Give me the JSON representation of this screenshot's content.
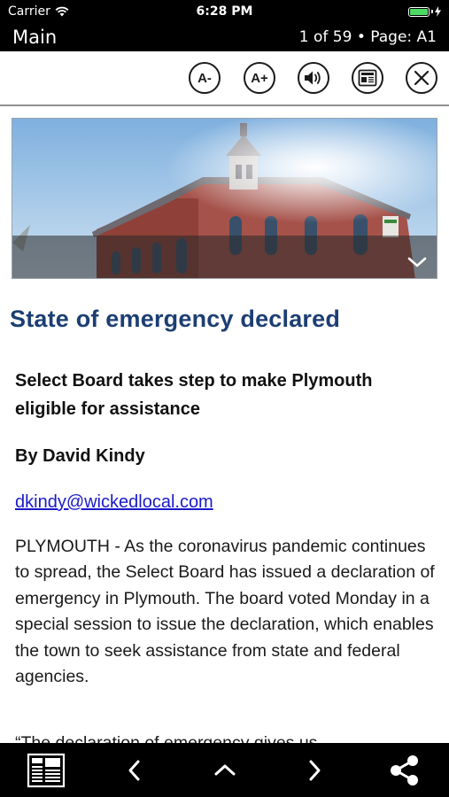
{
  "status_bar": {
    "carrier": "Carrier",
    "time": "6:28 PM"
  },
  "title_bar": {
    "section": "Main",
    "page_info": "1 of 59 • Page: A1"
  },
  "toolbar": {
    "decrease_font": "A-",
    "increase_font": "A+"
  },
  "article": {
    "headline": "State of emergency declared",
    "subheadline": "Select Board takes step to make Plymouth eligible for assistance",
    "byline": "By David Kindy",
    "email": "dkindy@wickedlocal.com",
    "paragraph_1": "PLYMOUTH - As the coronavirus pandemic continues to spread, the Select Board has issued a declaration of emergency in Plymouth. The board voted Monday in a special session to issue the declaration, which enables the town to seek assistance from state and federal agencies.",
    "paragraph_2_partial": "“The declaration of emergency gives us"
  },
  "colors": {
    "headline": "#1c3f73",
    "link": "#1a1acc",
    "bars": "#000000",
    "battery": "#4cd964"
  }
}
